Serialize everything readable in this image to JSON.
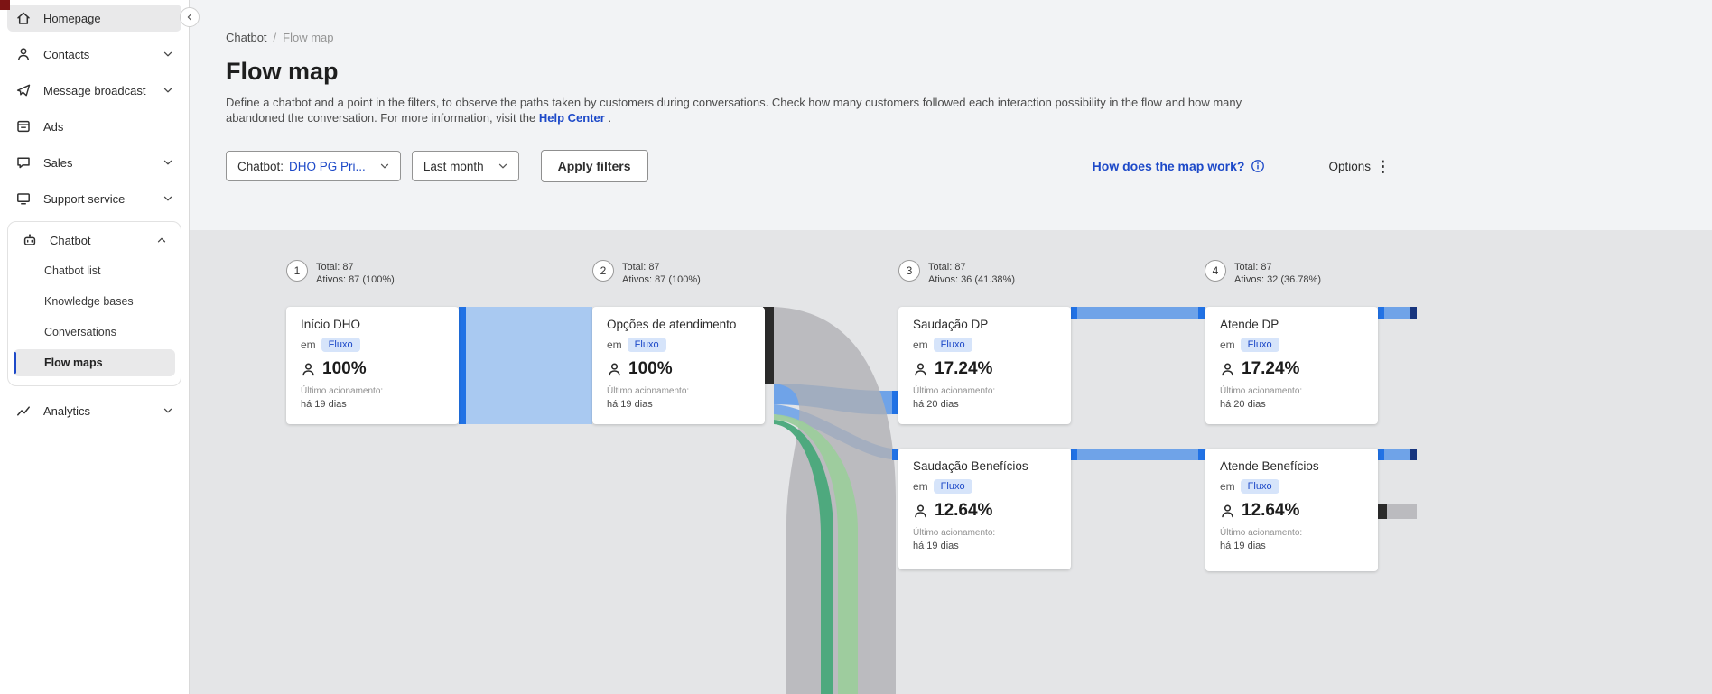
{
  "colors": {
    "accent_blue": "#1d49c8",
    "node_bar_blue": "#2172e5",
    "band_light_blue": "#a9c9f1",
    "band_medium_blue": "#6fa3e8",
    "band_gray": "#b0b0b3",
    "band_green_light": "#9ccc9c",
    "band_green": "#48a87a",
    "abandon_black": "#2b2b2b",
    "badge_bg": "#d6e4fa",
    "sankey_bg": "#e4e5e7"
  },
  "sidebar": {
    "items": [
      {
        "label": "Homepage",
        "icon": "home-icon",
        "selected": true
      },
      {
        "label": "Contacts",
        "icon": "contacts-icon",
        "chevron": "down"
      },
      {
        "label": "Message broadcast",
        "icon": "broadcast-icon",
        "chevron": "down"
      },
      {
        "label": "Ads",
        "icon": "ads-icon"
      },
      {
        "label": "Sales",
        "icon": "sales-icon",
        "chevron": "down"
      },
      {
        "label": "Support service",
        "icon": "support-icon",
        "chevron": "down"
      }
    ],
    "chatbot": {
      "label": "Chatbot",
      "icon": "chatbot-icon",
      "chevron": "up",
      "children": [
        {
          "label": "Chatbot list"
        },
        {
          "label": "Knowledge bases"
        },
        {
          "label": "Conversations"
        },
        {
          "label": "Flow maps",
          "selected": true
        }
      ]
    },
    "analytics": {
      "label": "Analytics",
      "icon": "analytics-icon",
      "chevron": "down"
    }
  },
  "breadcrumb": {
    "parent": "Chatbot",
    "separator": "/",
    "current": "Flow map"
  },
  "header": {
    "title": "Flow map",
    "desc_before": "Define a chatbot and a point in the filters, to observe the paths taken by customers during conversations. Check how many customers followed each interaction possibility in the flow and how many abandoned the conversation. For more information, visit the",
    "help_link": "Help Center",
    "desc_after": "."
  },
  "filters": {
    "chatbot_label": "Chatbot:",
    "chatbot_value": "DHO PG Pri...",
    "period_value": "Last month",
    "apply": "Apply filters",
    "help_link": "How does the map work?",
    "help_icon": "info-icon",
    "options": "Options",
    "options_icon": "kebab-icon"
  },
  "flow": {
    "columns": [
      {
        "number": "1",
        "total": "Total: 87",
        "actives": "Ativos: 87 (100%)"
      },
      {
        "number": "2",
        "total": "Total: 87",
        "actives": "Ativos: 87 (100%)"
      },
      {
        "number": "3",
        "total": "Total: 87",
        "actives": "Ativos: 36 (41.38%)"
      },
      {
        "number": "4",
        "total": "Total: 87",
        "actives": "Ativos: 32 (36.78%)"
      }
    ],
    "cards": [
      {
        "title": "Início DHO",
        "em": "em",
        "badge": "Fluxo",
        "percent": "100%",
        "last_label": "Último acionamento:",
        "last_value": "há 19 dias"
      },
      {
        "title": "Opções de atendimento",
        "em": "em",
        "badge": "Fluxo",
        "percent": "100%",
        "last_label": "Último acionamento:",
        "last_value": "há 19 dias"
      },
      {
        "title": "Saudação DP",
        "em": "em",
        "badge": "Fluxo",
        "percent": "17.24%",
        "last_label": "Último acionamento:",
        "last_value": "há 20 dias"
      },
      {
        "title": "Atende DP",
        "em": "em",
        "badge": "Fluxo",
        "percent": "17.24%",
        "last_label": "Último acionamento:",
        "last_value": "há 20 dias"
      },
      {
        "title": "Saudação Benefícios",
        "em": "em",
        "badge": "Fluxo",
        "percent": "12.64%",
        "last_label": "Último acionamento:",
        "last_value": "há 19 dias"
      },
      {
        "title": "Atende Benefícios",
        "em": "em",
        "badge": "Fluxo",
        "percent": "12.64%",
        "last_label": "Último acionamento:",
        "last_value": "há 19 dias"
      }
    ]
  }
}
